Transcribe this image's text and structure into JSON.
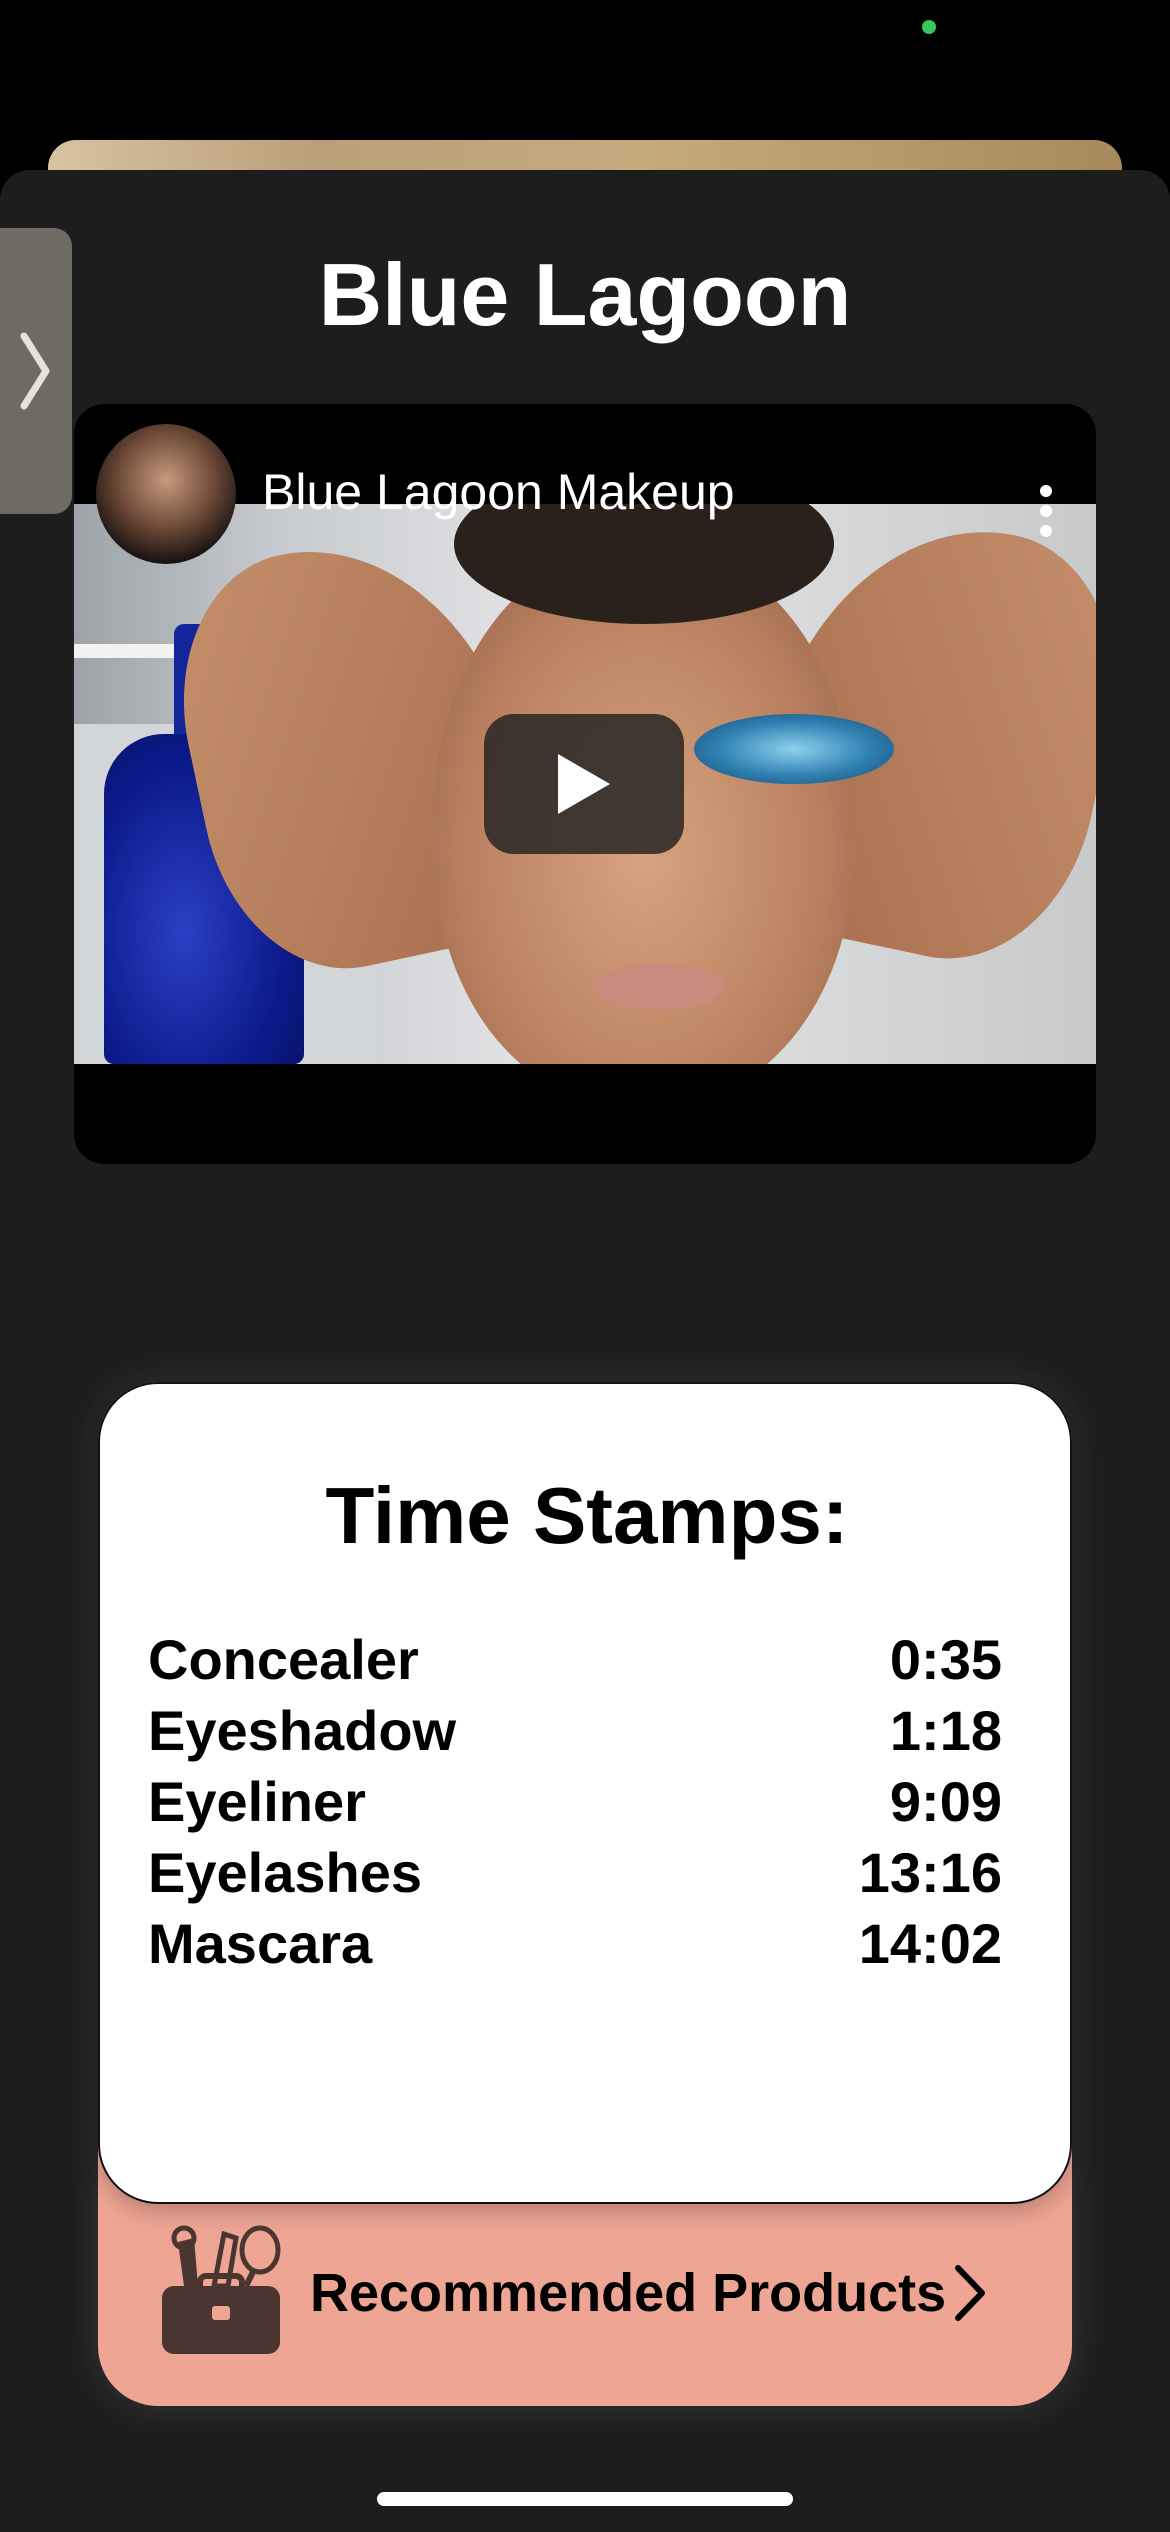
{
  "status": {
    "indicator_color": "#34c759"
  },
  "page": {
    "title": "Blue Lagoon"
  },
  "video": {
    "title": "Blue Lagoon Makeup",
    "play_icon": "play-icon",
    "menu_icon": "more-vertical-icon"
  },
  "timestamps": {
    "heading": "Time Stamps:",
    "items": [
      {
        "label": "Concealer",
        "time": "0:35"
      },
      {
        "label": "Eyeshadow",
        "time": "1:18"
      },
      {
        "label": "Eyeliner",
        "time": "9:09"
      },
      {
        "label": "Eyelashes",
        "time": "13:16"
      },
      {
        "label": "Mascara",
        "time": "14:02"
      }
    ]
  },
  "recommended": {
    "label": "Recommended Products",
    "icon": "makeup-bag-icon",
    "accent": "#eea594"
  },
  "colors": {
    "sheet_bg": "#1d1d1d",
    "card_bg": "#ffffff",
    "accent_peach": "#eea594"
  }
}
